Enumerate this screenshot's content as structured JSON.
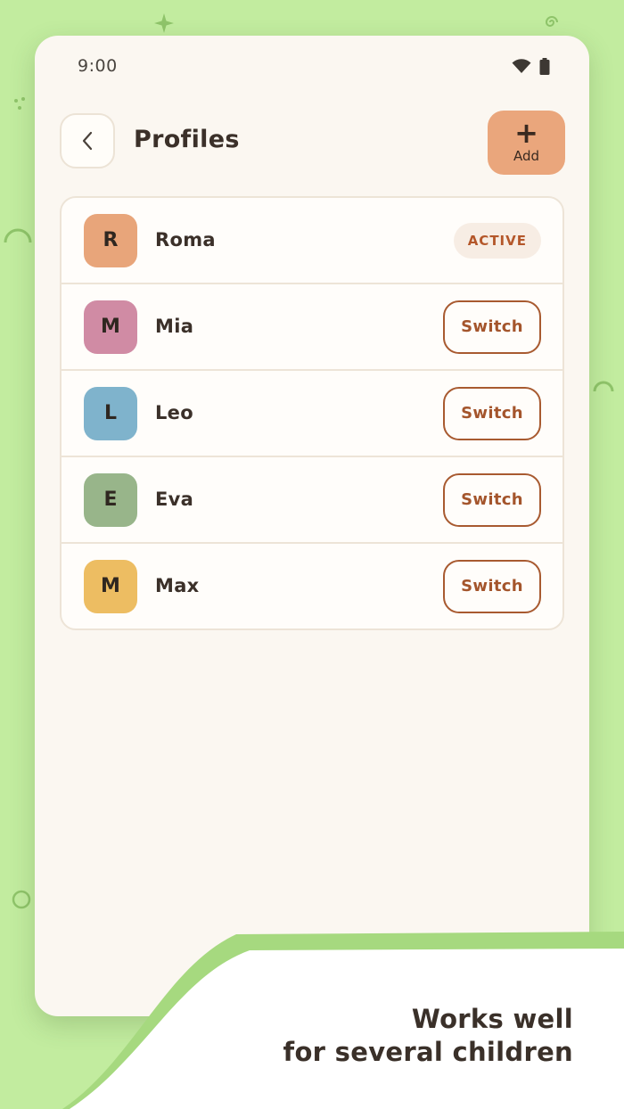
{
  "status_bar": {
    "time": "9:00",
    "icons": [
      "wifi-icon",
      "battery-icon"
    ]
  },
  "header": {
    "title": "Profiles",
    "back_icon": "chevron-left-icon",
    "add_icon": "plus-icon",
    "add_label": "Add"
  },
  "profiles": [
    {
      "initial": "R",
      "name": "Roma",
      "color": "#E8A57A",
      "status": "ACTIVE"
    },
    {
      "initial": "M",
      "name": "Mia",
      "color": "#D08BA4",
      "action": "Switch"
    },
    {
      "initial": "L",
      "name": "Leo",
      "color": "#7FB3CC",
      "action": "Switch"
    },
    {
      "initial": "E",
      "name": "Eva",
      "color": "#98B58A",
      "action": "Switch"
    },
    {
      "initial": "M",
      "name": "Max",
      "color": "#EDBD62",
      "action": "Switch"
    }
  ],
  "tagline": {
    "line1": "Works well",
    "line2": "for several children"
  },
  "colors": {
    "background": "#C2EC9F",
    "accent": "#EAA67C",
    "switch_border": "#A85A30",
    "card": "#FBF7F1"
  }
}
